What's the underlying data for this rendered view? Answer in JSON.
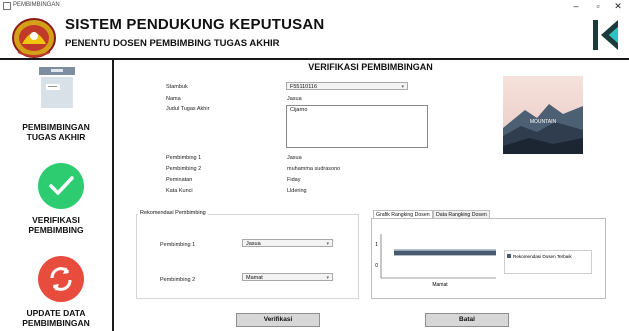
{
  "window": {
    "title": "PEMBIMBINGAN",
    "minimize": "–",
    "maximize": "▫",
    "close": "✕"
  },
  "header": {
    "title": "SISTEM PENDUKUNG KEPUTUSAN",
    "subtitle": "PENENTU DOSEN PEMBIMBING TUGAS AKHIR"
  },
  "sidebar": {
    "items": [
      {
        "label_line1": "PEMBIMBINGAN",
        "label_line2": "TUGAS AKHIR",
        "icon": "box-icon"
      },
      {
        "label_line1": "VERIFIKASI",
        "label_line2": "PEMBIMBING",
        "icon": "checkmark-icon",
        "color": "#2ecc71"
      },
      {
        "label_line1": "UPDATE DATA",
        "label_line2": "PEMBIMBINGAN",
        "icon": "refresh-icon",
        "color": "#e74c3c"
      }
    ]
  },
  "main": {
    "title": "VERIFIKASI PEMBIMBINGAN",
    "form": {
      "stambuk_label": "Stambuk",
      "stambuk_value": "F55110116",
      "nama_label": "Nama",
      "nama_value": "Jasua",
      "judul_label": "Judul Tugas Akhir",
      "judul_value": "Cijarno",
      "pembimbing1_label": "Pembimbing 1",
      "pembimbing1_value": "Jasua",
      "pembimbing2_label": "Pembimbing 2",
      "pembimbing2_value": "muhamma sudrasono",
      "peminatan_label": "Peminatan",
      "peminatan_value": "Fiday",
      "kata_kunci_label": "Kata Kunci",
      "kata_kunci_value": "Lldering"
    },
    "image_caption": "MOUNTAIN",
    "rekomendasi": {
      "group_title": "Rekomendasi Pembimbing",
      "p1_label": "Pembimbing 1",
      "p1_value": "Jasua",
      "p2_label": "Pembimbing 2",
      "p2_value": "Mamat"
    },
    "tabs": {
      "tab1": "Grafik Rangking Dosen",
      "tab2": "Data Rangking Dosen"
    },
    "buttons": {
      "verifikasi": "Verifikasi",
      "batal": "Batal"
    }
  },
  "chart_data": {
    "type": "bar",
    "categories": [
      "Mamat"
    ],
    "series": [
      {
        "name": "Rekomendasi Dosen Terbaik",
        "values": [
          0.6
        ]
      }
    ],
    "yticks": [
      "1",
      "0"
    ],
    "ylim": [
      0,
      1
    ],
    "legend": "right",
    "grid": false
  }
}
